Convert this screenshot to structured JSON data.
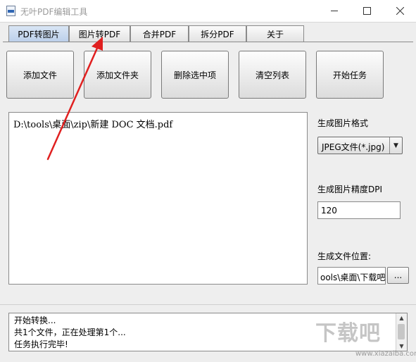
{
  "window": {
    "title": "无叶PDF编辑工具",
    "min_glyph": "—",
    "max_glyph": "☐",
    "close_glyph": "✕"
  },
  "tabs": [
    {
      "label": "PDF转图片",
      "active": true
    },
    {
      "label": "图片转PDF",
      "active": false
    },
    {
      "label": "合并PDF",
      "active": false
    },
    {
      "label": "拆分PDF",
      "active": false
    },
    {
      "label": "关于",
      "active": false
    }
  ],
  "toolbar": {
    "add_file": "添加文件",
    "add_folder": "添加文件夹",
    "delete_selected": "删除选中项",
    "clear_list": "清空列表",
    "start_task": "开始任务"
  },
  "file_list": [
    "D:\\tools\\桌面\\zip\\新建 DOC 文档.pdf"
  ],
  "settings": {
    "format_label": "生成图片格式",
    "format_value": "JPEG文件(*.jpg)",
    "dpi_label": "生成图片精度DPI",
    "dpi_value": "120",
    "output_label": "生成文件位置:",
    "output_value": "ools\\桌面\\下载吧",
    "browse_label": "..."
  },
  "log": [
    "开始转换...",
    "共1个文件，正在处理第1个...",
    "任务执行完毕!"
  ],
  "watermark": {
    "text": "下载吧",
    "sub": "www.xiazaiba.com"
  },
  "colors": {
    "annotation_arrow": "#e02020",
    "active_tab": "#c8d9ef"
  },
  "icons": {
    "app": "pdf-app-icon",
    "dropdown": "chevron-down-icon"
  }
}
